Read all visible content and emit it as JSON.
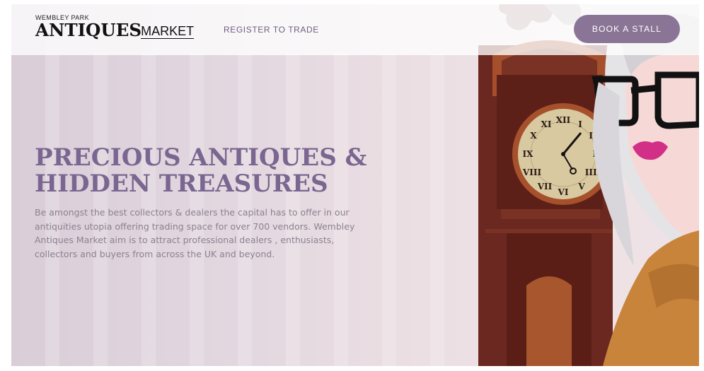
{
  "header": {
    "logo_top": "WEMBLEY PARK",
    "logo_antiques": "ANTIQUES",
    "logo_market": "MARKET",
    "nav_register": "REGISTER TO TRADE",
    "book_button": "BOOK A STALL"
  },
  "hero": {
    "title_line1": "PRECIOUS ANTIQUES &",
    "title_line2": "HIDDEN TREASURES",
    "description": "Be amongst the best collectors & dealers the capital has to offer in our antiquities utopia offering trading space for over 700 vendors. Wembley Antiques Market aim is to attract professional dealers , enthusiasts, collectors and buyers from across the UK and beyond."
  },
  "colors": {
    "accent": "#8b7596",
    "title": "#7a6690",
    "clock_wood": "#6a2a22",
    "clock_face": "#d8c9a0"
  }
}
